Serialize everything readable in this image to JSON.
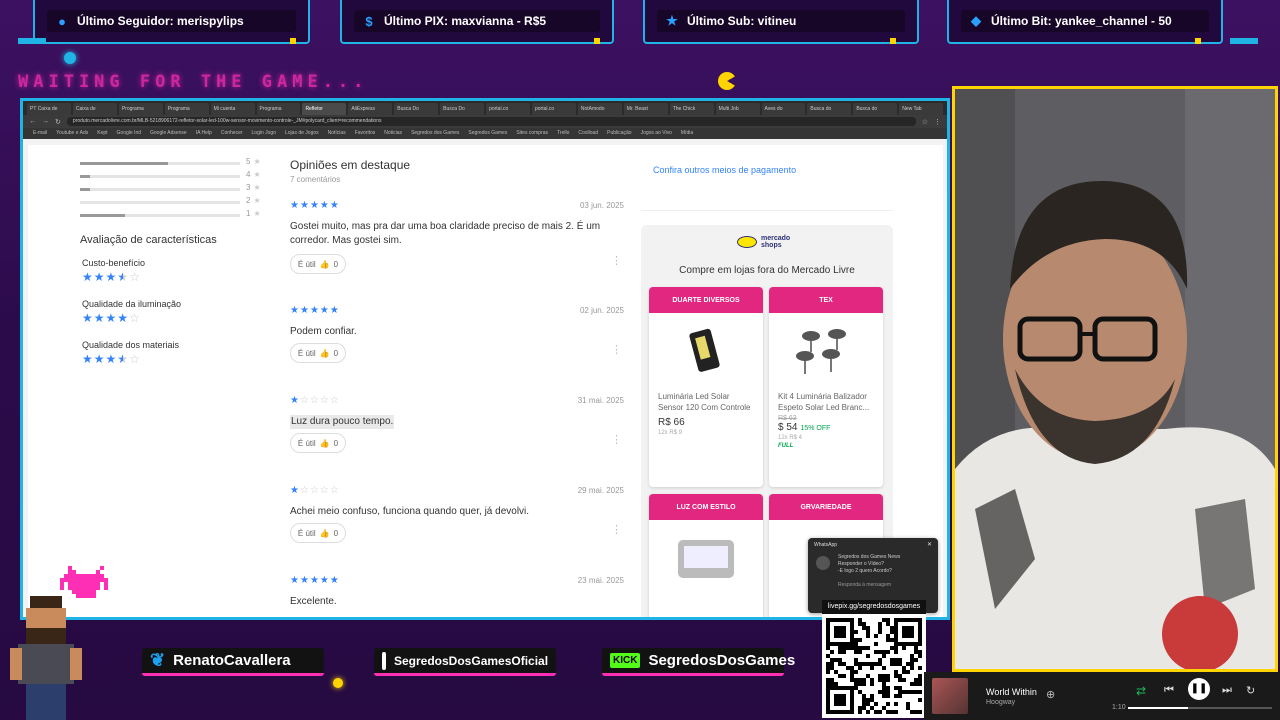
{
  "overlay": {
    "top_bars": [
      {
        "icon": "user-icon",
        "label": "Último Seguidor: merispylips"
      },
      {
        "icon": "dollar-icon",
        "label": "Último PIX: maxvianna - R$5"
      },
      {
        "icon": "star-icon",
        "label": "Último Sub: vitineu"
      },
      {
        "icon": "diamond-icon",
        "label": "Último Bit: yankee_channel - 50"
      }
    ],
    "waiting_text": "WAITING FOR THE GAME...",
    "socials": [
      {
        "icon": "twitter-icon",
        "label": "RenatoCavallera"
      },
      {
        "icon": "instagram-icon",
        "label": "SegredosDosGamesOficial"
      },
      {
        "icon": "kick-icon",
        "badge": "KICK",
        "label": "SegredosDosGames"
      }
    ],
    "livepix_url": "livepix.gg/segredosdosgames",
    "accent": "#1fb3e6",
    "pink": "#ff2fb5",
    "yellow": "#ffd400"
  },
  "browser": {
    "tabs": [
      "PT Caixa de",
      "Caixa de",
      "Programa",
      "Programa",
      "Mi cuenta",
      "Programa",
      "Refletor",
      "AliExpress",
      "Busca Do",
      "Busca Do",
      "portal.co",
      "portal.co",
      "NotAmodo",
      "Mr. Beast",
      "The Chick",
      "Multi Job",
      "Aves do",
      "Busca do",
      "Busca do",
      "New Tab"
    ],
    "active_tab": 6,
    "url": "produto.mercadolivre.com.br/MLB-5218906172-refletor-solar-led-100w-sensor-movimento-controle-_JM#polycard_client=recommendations",
    "bookmarks": [
      "E-mail",
      "Youtube e Ads",
      "Kept",
      "Google Ind",
      "Google Adsense",
      "IA Help",
      "Conhecer",
      "Login Jogo",
      "Lojas de Jogos",
      "Notícias",
      "Favoritos",
      "Noticias",
      "Segredos dos Games",
      "Segredos Games",
      "Sites compras",
      "Trello",
      "Coolload",
      "Publicação",
      "Jogos ao Vivo",
      "Mídia"
    ]
  },
  "rating_breakdown": [
    {
      "stars": "5",
      "fill": 0.55
    },
    {
      "stars": "4",
      "fill": 0.06
    },
    {
      "stars": "3",
      "fill": 0.06
    },
    {
      "stars": "2",
      "fill": 0.0
    },
    {
      "stars": "1",
      "fill": 0.28
    }
  ],
  "characteristics": {
    "title": "Avaliação de características",
    "items": [
      {
        "label": "Custo-benefício",
        "rating": 3.5
      },
      {
        "label": "Qualidade da iluminação",
        "rating": 4
      },
      {
        "label": "Qualidade dos materiais",
        "rating": 3.5
      }
    ]
  },
  "reviews": {
    "title": "Opiniões em destaque",
    "count_label": "7 comentários",
    "helpful_label": "É útil",
    "items": [
      {
        "stars": 5,
        "date": "03 jun. 2025",
        "text": "Gostei muito, mas pra dar uma boa claridade preciso de mais 2. É um corredor. Mas gostei sim.",
        "likes": "0"
      },
      {
        "stars": 5,
        "date": "02 jun. 2025",
        "text": "Podem confiar.",
        "likes": "0"
      },
      {
        "stars": 1,
        "date": "31 mai. 2025",
        "text": "Luz dura pouco tempo.",
        "likes": "0"
      },
      {
        "stars": 1,
        "date": "29 mai. 2025",
        "text": "Achei meio confuso, funciona quando quer, já devolvi.",
        "likes": "0"
      },
      {
        "stars": 5,
        "date": "23 mai. 2025",
        "text": "Excelente.",
        "likes": "0"
      }
    ]
  },
  "payment_link": "Confira outros meios de pagamento",
  "shops": {
    "logo_text": "mercado shops",
    "title": "Compre em lojas fora do Mercado Livre",
    "cards": [
      {
        "store": "DUARTE DIVERSOS",
        "title": "Luminária Led Solar Sensor 120 Com Controle",
        "old_price": "",
        "price": "R$ 66",
        "discount": "",
        "installments": "12x R$ 9",
        "badge": ""
      },
      {
        "store": "TEX",
        "title": "Kit 4 Luminária Balizador Espeto Solar Led Branc...",
        "old_price": "R$ 63",
        "price": "$ 54",
        "discount": "15% OFF",
        "installments": "12x R$ 4",
        "badge": "FULL"
      },
      {
        "store": "LUZ COM ESTILO",
        "title": "",
        "old_price": "",
        "price": "",
        "discount": "",
        "installments": "",
        "badge": ""
      },
      {
        "store": "GRVARIEDADE",
        "title": "",
        "old_price": "",
        "price": "",
        "discount": "",
        "installments": "",
        "badge": ""
      }
    ]
  },
  "whatsapp_popup": {
    "title": "WhatsApp",
    "message": "Segredos dos Games News\nResponder o Vídeo?\n-E logo 2 quero Acordo?",
    "footer": "Responda à mensagem"
  },
  "music": {
    "title": "World Within",
    "artist": "Hoogway",
    "elapsed": "1:10",
    "progress": 0.42
  }
}
